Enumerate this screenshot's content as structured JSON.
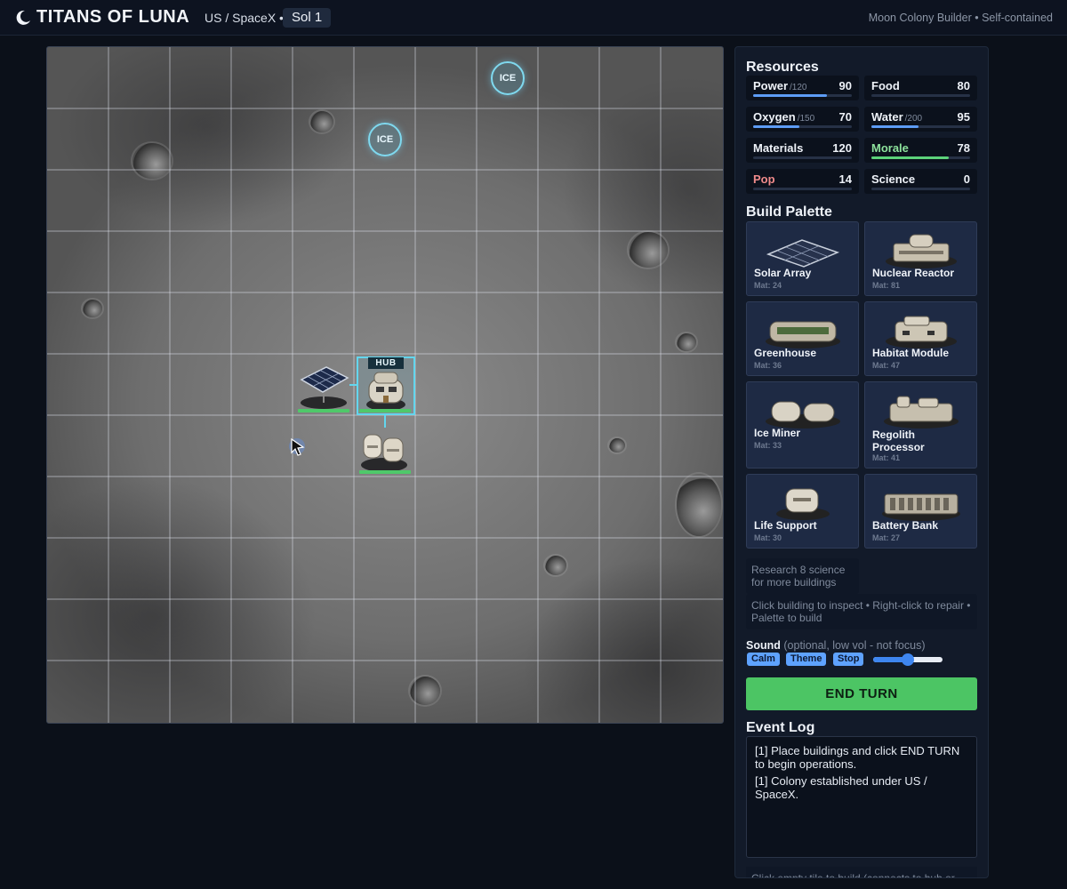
{
  "header": {
    "title": "TITANS OF LUNA",
    "faction": "US / SpaceX •",
    "sol": "Sol 1",
    "tagline": "Moon Colony Builder • Self-contained"
  },
  "map": {
    "ice_label": "ICE",
    "hub_label": "HUB"
  },
  "resources": {
    "title": "Resources",
    "items": [
      {
        "name": "Power",
        "max": "/120",
        "value": "90",
        "fill": 0.75,
        "color": "#5d9cf5",
        "name_color": "#eef2f8"
      },
      {
        "name": "Food",
        "max": "",
        "value": "80",
        "fill": 0,
        "color": "#5d9cf5",
        "name_color": "#eef2f8"
      },
      {
        "name": "Oxygen",
        "max": "/150",
        "value": "70",
        "fill": 0.47,
        "color": "#5d9cf5",
        "name_color": "#eef2f8"
      },
      {
        "name": "Water",
        "max": "/200",
        "value": "95",
        "fill": 0.475,
        "color": "#5d9cf5",
        "name_color": "#eef2f8"
      },
      {
        "name": "Materials",
        "max": "",
        "value": "120",
        "fill": 0,
        "color": "#5d9cf5",
        "name_color": "#eef2f8"
      },
      {
        "name": "Morale",
        "max": "",
        "value": "78",
        "fill": 0.78,
        "color": "#5cd27a",
        "name_color": "#8ee39d"
      },
      {
        "name": "Pop",
        "max": "",
        "value": "14",
        "fill": 0,
        "color": "#5d9cf5",
        "name_color": "#f08b8b"
      },
      {
        "name": "Science",
        "max": "",
        "value": "0",
        "fill": 0,
        "color": "#5d9cf5",
        "name_color": "#eef2f8"
      }
    ]
  },
  "palette": {
    "title": "Build Palette",
    "items": [
      {
        "name": "Solar Array",
        "cost": "Mat: 24",
        "icon": "solar-array-icon"
      },
      {
        "name": "Nuclear Reactor",
        "cost": "Mat: 81",
        "icon": "nuclear-reactor-icon"
      },
      {
        "name": "Greenhouse",
        "cost": "Mat: 36",
        "icon": "greenhouse-icon"
      },
      {
        "name": "Habitat Module",
        "cost": "Mat: 47",
        "icon": "habitat-module-icon"
      },
      {
        "name": "Ice Miner",
        "cost": "Mat: 33",
        "icon": "ice-miner-icon"
      },
      {
        "name": "Regolith Processor",
        "cost": "Mat: 41",
        "icon": "regolith-processor-icon"
      },
      {
        "name": "Life Support",
        "cost": "Mat: 30",
        "icon": "life-support-icon"
      },
      {
        "name": "Battery Bank",
        "cost": "Mat: 27",
        "icon": "battery-bank-icon"
      }
    ],
    "research_note": "Research 8 science for more buildings",
    "help_note": "Click building to inspect • Right-click to repair • Palette to build"
  },
  "sound": {
    "label": "Sound",
    "hint": "(optional, low vol - not focus)",
    "buttons": [
      "Calm",
      "Theme",
      "Stop"
    ],
    "volume": 0.5
  },
  "end_turn_label": "END TURN",
  "event_log": {
    "title": "Event Log",
    "lines": [
      "[1] Place buildings and click END TURN to begin operations.",
      "[1] Colony established under US / SpaceX."
    ]
  },
  "footer_hint": "Click empty tile to build (connects to hub or"
}
